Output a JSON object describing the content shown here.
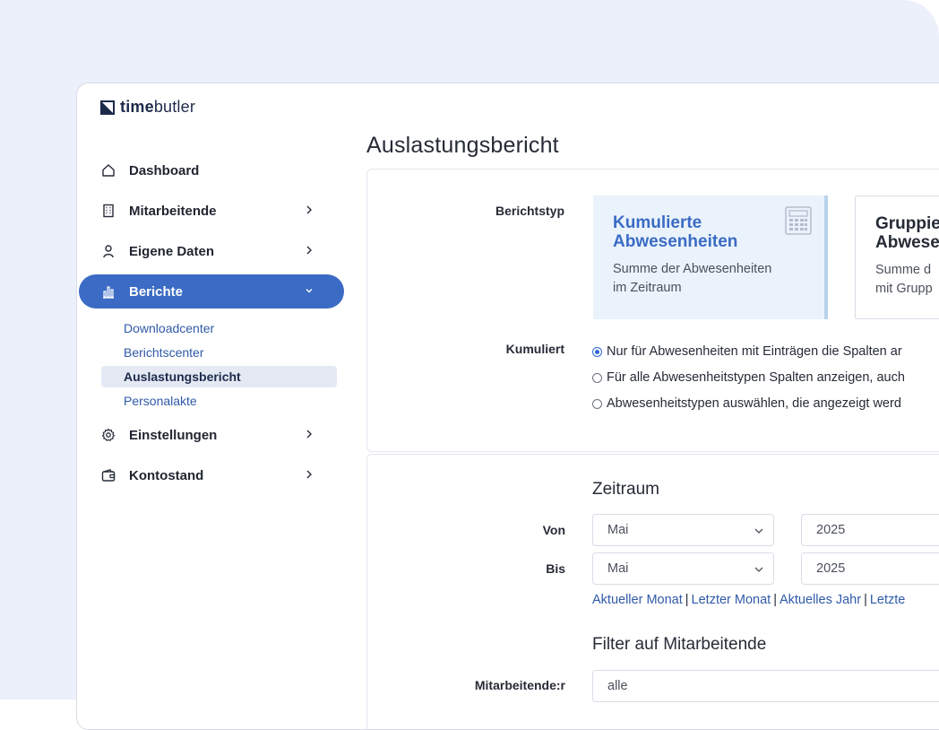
{
  "app": {
    "logo_bold": "time",
    "logo_light": "butler"
  },
  "sidebar": {
    "items": [
      {
        "label": "Dashboard"
      },
      {
        "label": "Mitarbeitende"
      },
      {
        "label": "Eigene Daten"
      },
      {
        "label": "Berichte"
      },
      {
        "label": "Einstellungen"
      },
      {
        "label": "Kontostand"
      }
    ],
    "subitems": [
      {
        "label": "Downloadcenter"
      },
      {
        "label": "Berichtscenter"
      },
      {
        "label": "Auslastungsbericht"
      },
      {
        "label": "Personalakte"
      }
    ]
  },
  "main": {
    "title": "Auslastungsbericht",
    "report_type": {
      "label": "Berichtstyp",
      "cards": [
        {
          "title_line1": "Kumulierte",
          "title_line2": "Abwesenheiten",
          "desc_line1": "Summe der Abwesenheiten",
          "desc_line2": "im Zeitraum"
        },
        {
          "title_line1": "Gruppie",
          "title_line2": "Abwese",
          "desc_line1": "Summe d",
          "desc_line2": "mit Grupp"
        }
      ]
    },
    "cumulative": {
      "label": "Kumuliert",
      "options": [
        "Nur für Abwesenheiten mit Einträgen die Spalten ar",
        "Für alle Abwesenheitstypen Spalten anzeigen, auch",
        "Abwesenheitstypen auswählen, die angezeigt werd"
      ]
    },
    "period": {
      "heading": "Zeitraum",
      "from_label": "Von",
      "to_label": "Bis",
      "from_month": "Mai",
      "from_year": "2025",
      "to_month": "Mai",
      "to_year": "2025",
      "quick_links": [
        "Aktueller Monat",
        "Letzter Monat",
        "Aktuelles Jahr",
        "Letzte"
      ],
      "separator": "|"
    },
    "filter": {
      "heading": "Filter auf Mitarbeitende",
      "label": "Mitarbeitende:r",
      "value": "alle"
    }
  },
  "colors": {
    "accent": "#3b6bc4",
    "background": "#ecf0fa"
  }
}
